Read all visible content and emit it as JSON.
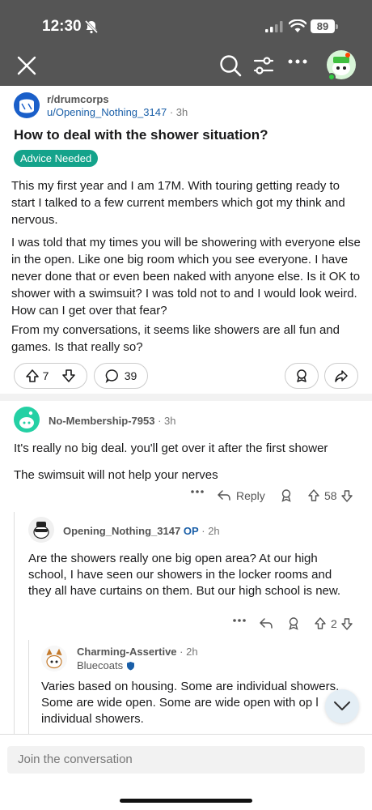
{
  "status": {
    "time": "12:30",
    "battery": "89"
  },
  "post": {
    "subreddit": "r/drumcorps",
    "author": "u/Opening_Nothing_3147",
    "time": "3h",
    "title": "How to deal with the shower situation?",
    "flair": "Advice Needed",
    "paragraphs": [
      "This my first year and I am 17M. With touring getting ready to start I talked to a few current members which got my think and nervous.",
      "I was told that my times you will be showering with everyone else in the open. Like one big room which you see everyone. I have never done that or even been naked with anyone else. Is it OK to shower with a swimsuit? I was told not to and I would look weird. How can I get over that fear?",
      "From my conversations, it seems like showers are all fun and games. Is that really so?"
    ],
    "votes": "7",
    "comments": "39"
  },
  "comments": [
    {
      "author": "No-Membership-7953",
      "time": "3h",
      "paragraphs": [
        "It's really no big deal. you'll get over it after the first shower",
        "The swimsuit will not help your nerves"
      ],
      "reply_label": "Reply",
      "votes": "58"
    },
    {
      "author": "Opening_Nothing_3147",
      "op_badge": "OP",
      "time": "2h",
      "text": "Are the showers really one big open area? At our high school, I have seen our showers in the locker rooms and they all have curtains on them. But our high school is new.",
      "votes": "2"
    },
    {
      "author": "Charming-Assertive",
      "time": "2h",
      "user_flair": "Bluecoats",
      "text": "Varies based on housing. Some are individual showers. Some are wide open. Some are wide open with op     l individual showers."
    }
  ],
  "compose": {
    "placeholder": "Join the conversation"
  },
  "colors": {
    "topbar": "#555555",
    "flair": "#14a38b",
    "link": "#1a5fa8"
  }
}
